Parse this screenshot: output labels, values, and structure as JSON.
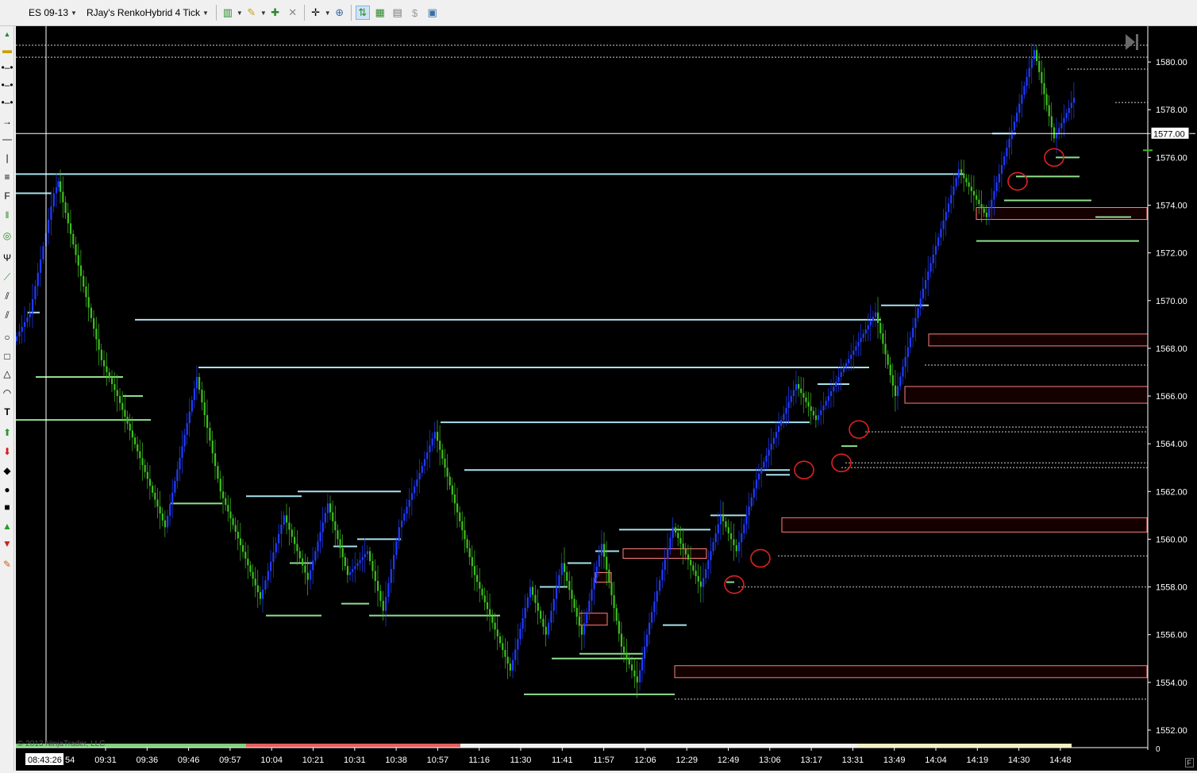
{
  "toolbar": {
    "instrument": "ES 09-13",
    "chart_type": "RJay's RenkoHybrid  4 Tick"
  },
  "chart_data": {
    "type": "renko-candlestick",
    "instrument": "ES 09-13",
    "bar_type": "RJay's RenkoHybrid  4 Tick",
    "x_tick_labels": [
      "09:31",
      "09:36",
      "09:46",
      "09:57",
      "10:04",
      "10:21",
      "10:31",
      "10:38",
      "10:57",
      "11:16",
      "11:30",
      "11:41",
      "11:57",
      "12:06",
      "12:29",
      "12:49",
      "13:06",
      "13:17",
      "13:31",
      "13:49",
      "14:04",
      "14:19",
      "14:30",
      "14:48"
    ],
    "crosshair_time": "08:43:26",
    "crosshair_time_partial": "54",
    "y_tick_labels": [
      "1580.00",
      "1578.00",
      "1576.00",
      "1574.00",
      "1572.00",
      "1570.00",
      "1568.00",
      "1566.00",
      "1564.00",
      "1562.00",
      "1560.00",
      "1558.00",
      "1556.00",
      "1554.00",
      "1552.00"
    ],
    "ylim": [
      1551.3,
      1581.5
    ],
    "crosshair_price": "1577.00",
    "last_price": 1576.3,
    "zero_label": "0",
    "footer_copyright": "© 2013 NinjaTrader, LLC",
    "status_flag": "F",
    "colors": {
      "background": "#000000",
      "up_bar": "#1f3cff",
      "down_bar": "#3fbf1f",
      "resistance_line": "#a8e2ee",
      "support_line": "#8fe08f",
      "zone_border": "#ff7f7f",
      "marker_circle": "#e02020",
      "dotted_level": "#8a8a8a",
      "session_green": "#7ed07e",
      "session_red": "#e06060",
      "session_white": "#f0f0f0",
      "session_yellow": "#f0f0c0"
    },
    "price_path": [
      [
        0.0,
        1568.3
      ],
      [
        0.02,
        1569.5
      ],
      [
        0.05,
        1574.5
      ],
      [
        0.055,
        1575.0
      ],
      [
        0.11,
        1567.5
      ],
      [
        0.13,
        1566.0
      ],
      [
        0.19,
        1560.5
      ],
      [
        0.23,
        1566.8
      ],
      [
        0.26,
        1562.0
      ],
      [
        0.31,
        1557.5
      ],
      [
        0.34,
        1561.0
      ],
      [
        0.37,
        1558.3
      ],
      [
        0.395,
        1561.5
      ],
      [
        0.42,
        1558.5
      ],
      [
        0.445,
        1559.5
      ],
      [
        0.465,
        1557.0
      ],
      [
        0.485,
        1560.5
      ],
      [
        0.53,
        1564.5
      ],
      [
        0.58,
        1558.5
      ],
      [
        0.625,
        1554.5
      ],
      [
        0.65,
        1558.0
      ],
      [
        0.67,
        1556.0
      ],
      [
        0.69,
        1559.0
      ],
      [
        0.715,
        1556.0
      ],
      [
        0.74,
        1559.8
      ],
      [
        0.765,
        1555.5
      ],
      [
        0.785,
        1554.0
      ],
      [
        0.8,
        1556.5
      ],
      [
        0.83,
        1560.5
      ],
      [
        0.865,
        1558.0
      ],
      [
        0.89,
        1561.0
      ],
      [
        0.91,
        1559.5
      ],
      [
        0.935,
        1562.5
      ],
      [
        0.985,
        1566.5
      ],
      [
        1.01,
        1565.0
      ],
      [
        1.045,
        1567.2
      ],
      [
        1.085,
        1569.5
      ],
      [
        1.11,
        1566.0
      ],
      [
        1.145,
        1570.5
      ],
      [
        1.19,
        1575.5
      ],
      [
        1.225,
        1573.5
      ],
      [
        1.26,
        1577.5
      ],
      [
        1.285,
        1580.5
      ],
      [
        1.31,
        1576.8
      ],
      [
        1.335,
        1578.5
      ]
    ],
    "resistance_levels": [
      {
        "price": 1574.5,
        "x_start": 0.0,
        "x_end": 0.045
      },
      {
        "price": 1575.3,
        "x_start": 0.0,
        "x_end": 1.195
      },
      {
        "price": 1569.5,
        "x_start": 0.015,
        "x_end": 0.03
      },
      {
        "price": 1569.2,
        "x_start": 0.15,
        "x_end": 1.09
      },
      {
        "price": 1567.2,
        "x_start": 0.23,
        "x_end": 1.075
      },
      {
        "price": 1564.9,
        "x_start": 0.535,
        "x_end": 1.0
      },
      {
        "price": 1562.9,
        "x_start": 0.565,
        "x_end": 0.975
      },
      {
        "price": 1561.8,
        "x_start": 0.29,
        "x_end": 0.36
      },
      {
        "price": 1562.0,
        "x_start": 0.355,
        "x_end": 0.485
      },
      {
        "price": 1559.7,
        "x_start": 0.4,
        "x_end": 0.43
      },
      {
        "price": 1560.0,
        "x_start": 0.43,
        "x_end": 0.485
      },
      {
        "price": 1560.4,
        "x_start": 0.76,
        "x_end": 0.875
      },
      {
        "price": 1561.0,
        "x_start": 0.875,
        "x_end": 0.92
      },
      {
        "price": 1558.0,
        "x_start": 0.66,
        "x_end": 0.695
      },
      {
        "price": 1559.0,
        "x_start": 0.695,
        "x_end": 0.725
      },
      {
        "price": 1559.5,
        "x_start": 0.73,
        "x_end": 0.76
      },
      {
        "price": 1556.4,
        "x_start": 0.815,
        "x_end": 0.845
      },
      {
        "price": 1562.7,
        "x_start": 0.945,
        "x_end": 0.975
      },
      {
        "price": 1566.5,
        "x_start": 1.01,
        "x_end": 1.05
      },
      {
        "price": 1567.2,
        "x_start": 1.05,
        "x_end": 1.075
      },
      {
        "price": 1569.8,
        "x_start": 1.09,
        "x_end": 1.15
      },
      {
        "price": 1577.0,
        "x_start": 1.23,
        "x_end": 1.26
      }
    ],
    "support_levels": [
      {
        "price": 1566.8,
        "x_start": 0.025,
        "x_end": 0.135
      },
      {
        "price": 1565.0,
        "x_start": 0.0,
        "x_end": 0.17
      },
      {
        "price": 1566.0,
        "x_start": 0.135,
        "x_end": 0.16
      },
      {
        "price": 1561.5,
        "x_start": 0.195,
        "x_end": 0.26
      },
      {
        "price": 1556.8,
        "x_start": 0.315,
        "x_end": 0.385
      },
      {
        "price": 1559.0,
        "x_start": 0.345,
        "x_end": 0.375
      },
      {
        "price": 1557.3,
        "x_start": 0.41,
        "x_end": 0.445
      },
      {
        "price": 1556.8,
        "x_start": 0.445,
        "x_end": 0.61
      },
      {
        "price": 1553.5,
        "x_start": 0.64,
        "x_end": 0.83
      },
      {
        "price": 1555.0,
        "x_start": 0.675,
        "x_end": 0.79
      },
      {
        "price": 1555.2,
        "x_start": 0.71,
        "x_end": 0.79
      },
      {
        "price": 1558.2,
        "x_start": 0.895,
        "x_end": 0.905
      },
      {
        "price": 1563.9,
        "x_start": 1.04,
        "x_end": 1.06
      },
      {
        "price": 1575.2,
        "x_start": 1.26,
        "x_end": 1.34
      },
      {
        "price": 1574.2,
        "x_start": 1.245,
        "x_end": 1.355
      },
      {
        "price": 1572.5,
        "x_start": 1.21,
        "x_end": 1.415
      },
      {
        "price": 1576.0,
        "x_start": 1.31,
        "x_end": 1.34
      },
      {
        "price": 1573.5,
        "x_start": 1.36,
        "x_end": 1.405
      }
    ],
    "zones": [
      {
        "top": 1559.5,
        "bottom": 1559.3,
        "x_start": 0.765,
        "x_end": 0.87
      },
      {
        "top": 1558.5,
        "bottom": 1558.3,
        "x_start": 0.73,
        "x_end": 0.75
      },
      {
        "top": 1556.8,
        "bottom": 1556.5,
        "x_start": 0.71,
        "x_end": 0.745
      },
      {
        "top": 1560.8,
        "bottom": 1560.4,
        "x_start": 0.965,
        "x_end": 1.425
      },
      {
        "top": 1568.5,
        "bottom": 1568.2,
        "x_start": 1.15,
        "x_end": 1.43
      },
      {
        "top": 1566.3,
        "bottom": 1565.8,
        "x_start": 1.12,
        "x_end": 1.43
      },
      {
        "top": 1554.6,
        "bottom": 1554.3,
        "x_start": 0.83,
        "x_end": 1.425
      },
      {
        "top": 1573.8,
        "bottom": 1573.5,
        "x_start": 1.21,
        "x_end": 1.425
      }
    ],
    "dotted_levels": [
      {
        "price": 1580.7,
        "x_start": 0.0,
        "x_end": 1.43
      },
      {
        "price": 1580.2,
        "x_start": 0.0,
        "x_end": 1.43
      },
      {
        "price": 1579.7,
        "x_start": 1.325,
        "x_end": 1.43
      },
      {
        "price": 1578.3,
        "x_start": 1.385,
        "x_end": 1.43
      },
      {
        "price": 1567.3,
        "x_start": 1.145,
        "x_end": 1.43
      },
      {
        "price": 1564.7,
        "x_start": 1.115,
        "x_end": 1.43
      },
      {
        "price": 1564.5,
        "x_start": 1.07,
        "x_end": 1.43
      },
      {
        "price": 1563.2,
        "x_start": 1.045,
        "x_end": 1.43
      },
      {
        "price": 1563.0,
        "x_start": 1.04,
        "x_end": 1.43
      },
      {
        "price": 1559.3,
        "x_start": 0.96,
        "x_end": 1.43
      },
      {
        "price": 1558.0,
        "x_start": 0.91,
        "x_end": 1.43
      },
      {
        "price": 1553.3,
        "x_start": 0.83,
        "x_end": 1.43
      }
    ],
    "markers": [
      {
        "x": 0.905,
        "price": 1558.1
      },
      {
        "x": 0.938,
        "price": 1559.2
      },
      {
        "x": 0.993,
        "price": 1562.9
      },
      {
        "x": 1.04,
        "price": 1563.2
      },
      {
        "x": 1.062,
        "price": 1564.6
      },
      {
        "x": 1.262,
        "price": 1575.0
      },
      {
        "x": 1.308,
        "price": 1576.0
      }
    ],
    "session_bar": [
      {
        "x_start": 0.0,
        "x_end": 0.29,
        "color": "session_green"
      },
      {
        "x_start": 0.29,
        "x_end": 0.56,
        "color": "session_red"
      },
      {
        "x_start": 0.56,
        "x_end": 1.06,
        "color": "session_white"
      },
      {
        "x_start": 1.06,
        "x_end": 1.33,
        "color": "session_yellow"
      }
    ]
  }
}
